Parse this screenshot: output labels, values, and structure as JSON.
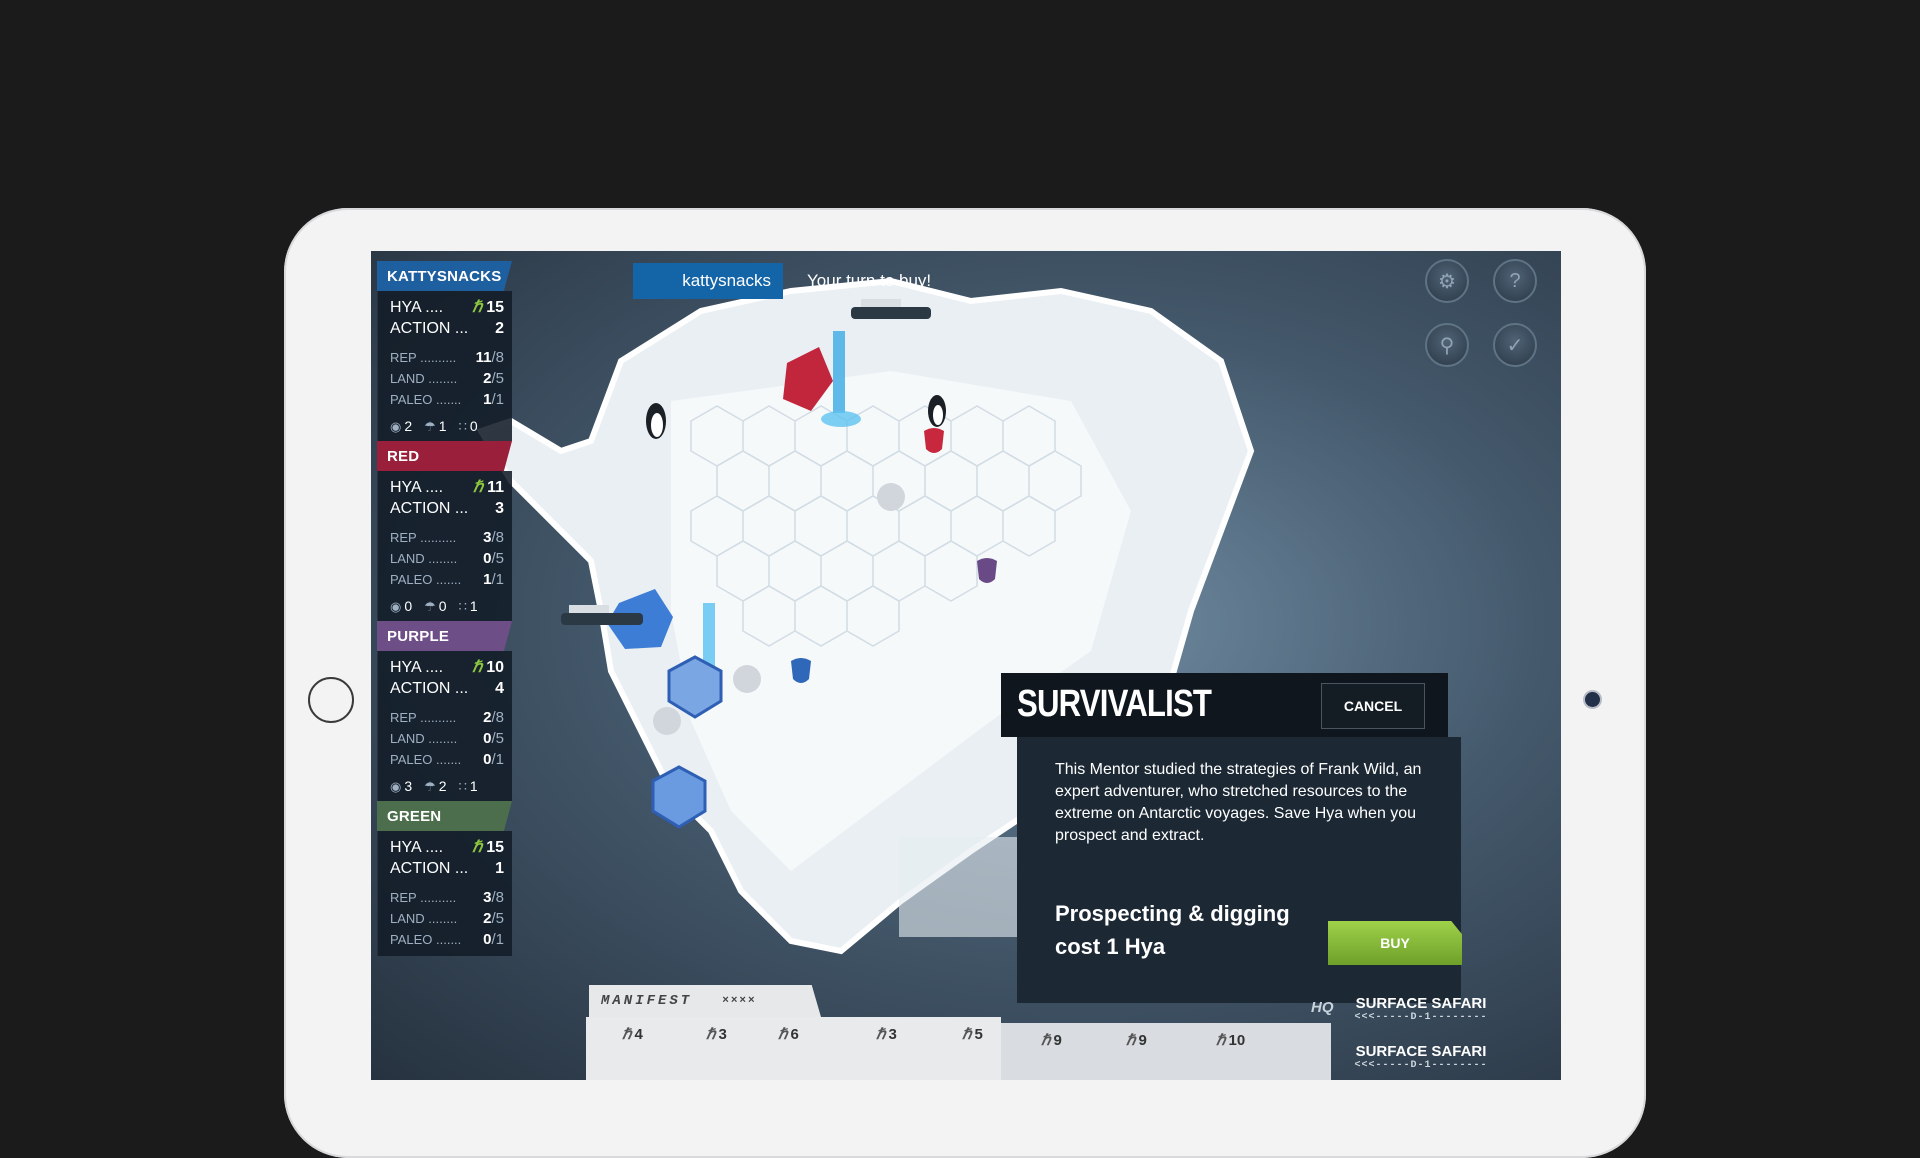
{
  "turn": {
    "player": "kattysnacks",
    "message": "Your turn to buy!"
  },
  "hya_glyph": "ℏ",
  "players": [
    {
      "name": "KATTYSNACKS",
      "color": "#1e5fa0",
      "hya_label": "HYA ....",
      "hya": "15",
      "action_label": "ACTION ...",
      "action": "2",
      "rep_label": "REP ..........",
      "rep": "11",
      "rep_max": "/8",
      "land_label": "LAND ........",
      "land": "2",
      "land_max": "/5",
      "paleo_label": "PALEO .......",
      "paleo": "1",
      "paleo_max": "/1",
      "icon_a": "2",
      "icon_b": "1",
      "icon_c": "0"
    },
    {
      "name": "RED",
      "color": "#9a1f3a",
      "hya_label": "HYA ....",
      "hya": "11",
      "action_label": "ACTION ...",
      "action": "3",
      "rep_label": "REP ..........",
      "rep": "3",
      "rep_max": "/8",
      "land_label": "LAND ........",
      "land": "0",
      "land_max": "/5",
      "paleo_label": "PALEO .......",
      "paleo": "1",
      "paleo_max": "/1",
      "icon_a": "0",
      "icon_b": "0",
      "icon_c": "1"
    },
    {
      "name": "PURPLE",
      "color": "#6e4e86",
      "hya_label": "HYA ....",
      "hya": "10",
      "action_label": "ACTION ...",
      "action": "4",
      "rep_label": "REP ..........",
      "rep": "2",
      "rep_max": "/8",
      "land_label": "LAND ........",
      "land": "0",
      "land_max": "/5",
      "paleo_label": "PALEO .......",
      "paleo": "0",
      "paleo_max": "/1",
      "icon_a": "3",
      "icon_b": "2",
      "icon_c": "1"
    },
    {
      "name": "GREEN",
      "color": "#4c6e4c",
      "hya_label": "HYA ....",
      "hya": "15",
      "action_label": "ACTION ...",
      "action": "1",
      "rep_label": "REP ..........",
      "rep": "3",
      "rep_max": "/8",
      "land_label": "LAND ........",
      "land": "2",
      "land_max": "/5",
      "paleo_label": "PALEO .......",
      "paleo": "0",
      "paleo_max": "/1",
      "icon_a": "",
      "icon_b": "",
      "icon_c": ""
    }
  ],
  "controls": {
    "settings_icon": "gear-icon",
    "help_icon": "question-icon",
    "zoom_icon": "magnifier-icon",
    "end_icon": "check-icon"
  },
  "dialog": {
    "title": "SURVIVALIST",
    "cancel_label": "CANCEL",
    "description": "This Mentor studied the strategies of Frank Wild, an expert adventurer, who stretched resources to the extreme on Antarctic voyages. Save Hya when you prospect and extract.",
    "perk": "Prospecting & digging cost 1 Hya",
    "buy_label": "BUY"
  },
  "manifest": {
    "title": "MANIFEST",
    "ship_code": "××××",
    "card_costs": [
      "4",
      "3",
      "6",
      "3",
      "5",
      "9",
      "9",
      "10"
    ]
  },
  "hq": {
    "label": "HQ",
    "items": [
      {
        "name": "SURFACE SAFARI",
        "track": "<<<-----D-1--------"
      },
      {
        "name": "SURFACE SAFARI",
        "track": "<<<-----D-1--------"
      }
    ]
  }
}
